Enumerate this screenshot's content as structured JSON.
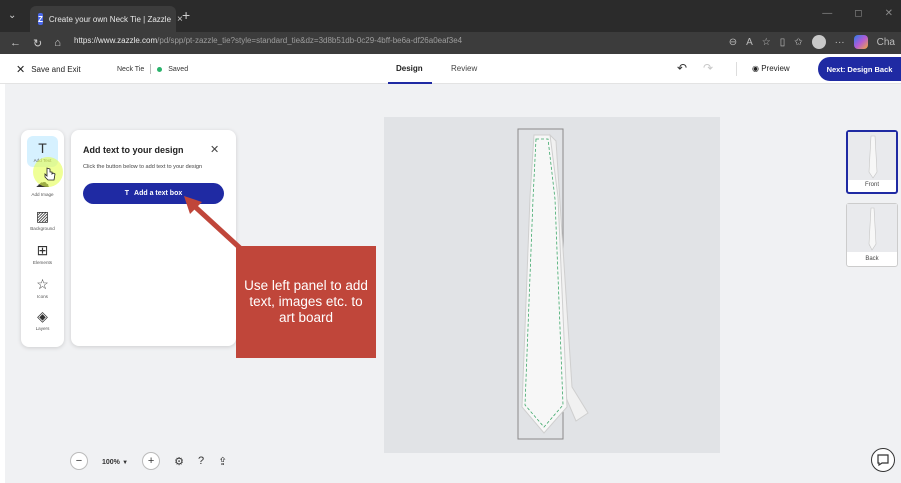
{
  "browser": {
    "tab_title": "Create your own Neck Tie | Zazzle",
    "favicon_letter": "Z",
    "tab_close": "×",
    "new_tab": "+",
    "url_host": "https://www.zazzle.com",
    "url_path": "/pd/spp/pt-zazzle_tie?style=standard_tie&dz=3d8b51db-0c29-4bff-be6a-df26a0eaf3e4",
    "right_label": "Cha"
  },
  "header": {
    "save_exit": "Save and Exit",
    "product": "Neck Tie",
    "status": "Saved",
    "tabs": {
      "design": "Design",
      "review": "Review"
    },
    "preview": "Preview",
    "next": "Next: Design Back"
  },
  "rail": {
    "items": [
      {
        "label": "Add Text",
        "icon": "T"
      },
      {
        "label": "Add Image",
        "icon": "☁"
      },
      {
        "label": "Background",
        "icon": "▨"
      },
      {
        "label": "Elements",
        "icon": "⊞"
      },
      {
        "label": "Icons",
        "icon": "☆"
      },
      {
        "label": "Layers",
        "icon": "◈"
      }
    ]
  },
  "panel": {
    "title": "Add text to your design",
    "description": "Click the button below to add text to your design",
    "button": "Add a text box",
    "button_icon": "T"
  },
  "callout": {
    "text": "Use left panel to add text, images etc. to art board"
  },
  "thumbnails": [
    {
      "label": "Front"
    },
    {
      "label": "Back"
    }
  ],
  "zoom": {
    "value": "100%",
    "dropdown": "▼"
  },
  "colors": {
    "brand": "#1f2aa3",
    "callout": "#c0463a",
    "saved_dot": "#29b36b"
  }
}
